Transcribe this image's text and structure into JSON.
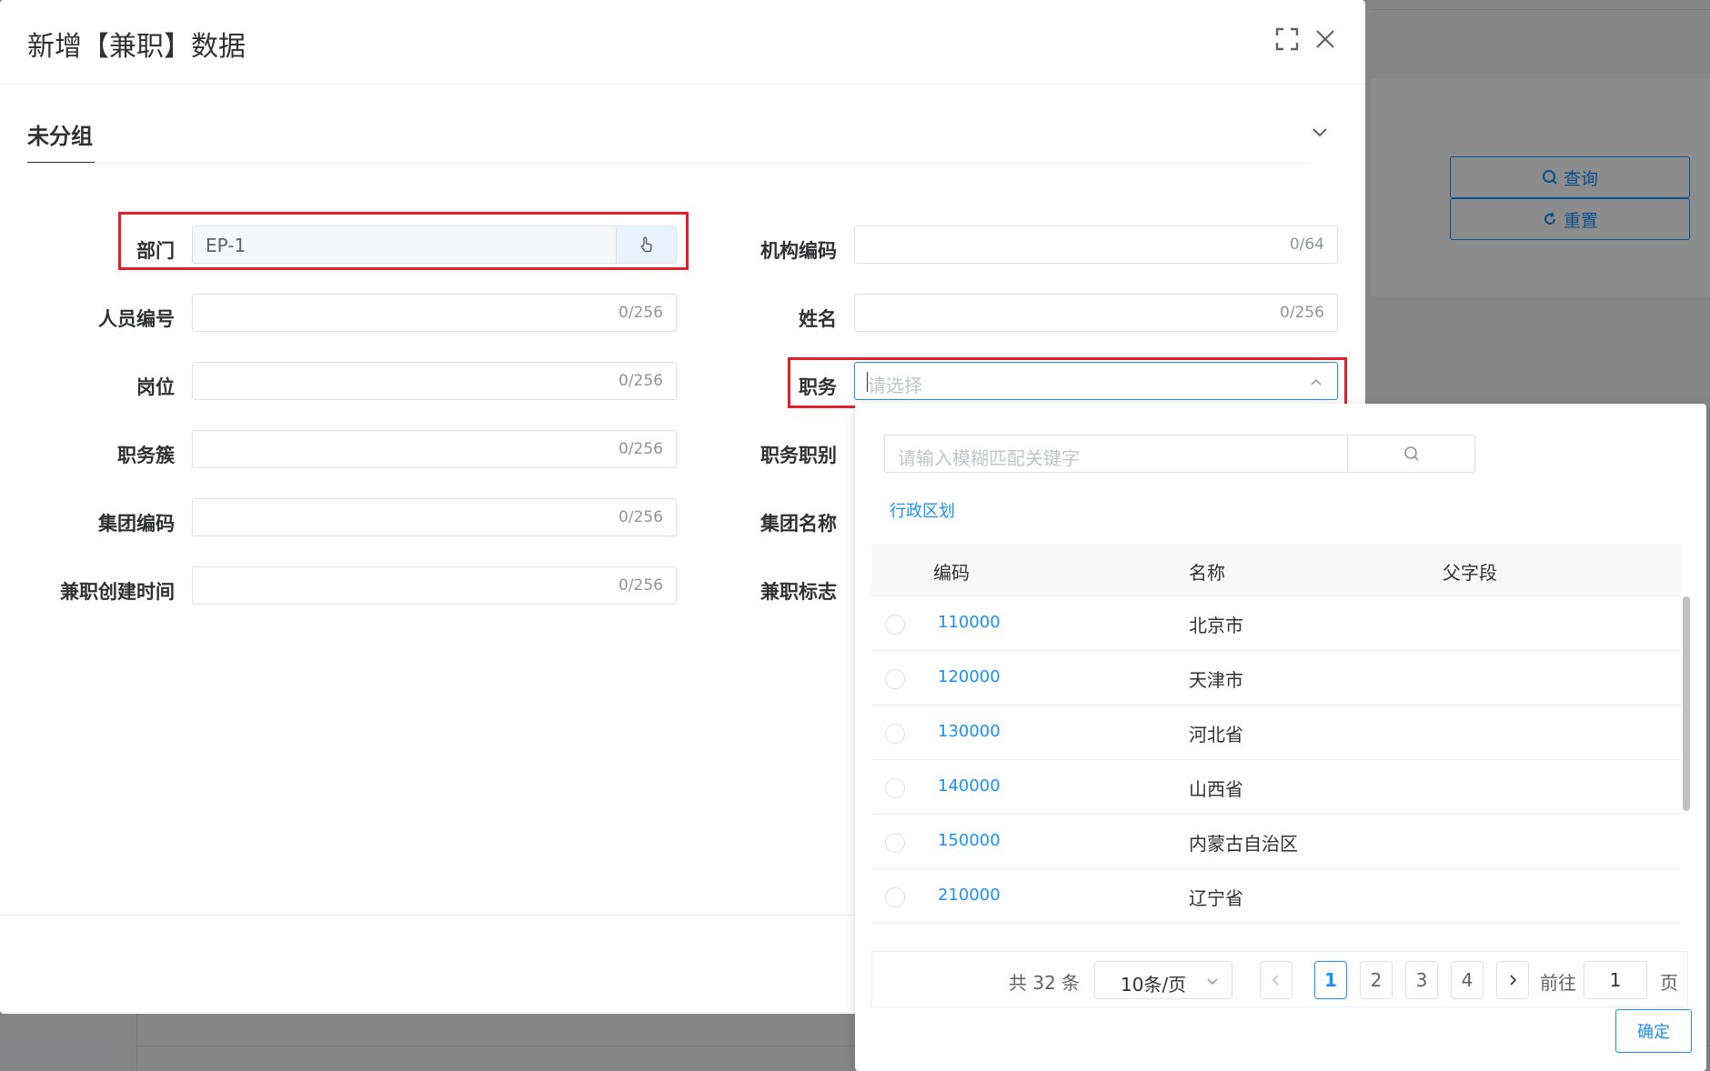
{
  "dialog": {
    "title": "新增【兼职】数据",
    "group_title": "未分组"
  },
  "background": {
    "query_label": "查询",
    "reset_label": "重置"
  },
  "form": {
    "department": {
      "label": "部门",
      "value": "EP-1"
    },
    "org_code": {
      "label": "机构编码",
      "counter": "0/64"
    },
    "person_no": {
      "label": "人员编号",
      "counter": "0/256"
    },
    "name": {
      "label": "姓名",
      "counter": "0/256"
    },
    "post": {
      "label": "岗位",
      "counter": "0/256"
    },
    "duty": {
      "label": "职务",
      "placeholder": "请选择"
    },
    "duty_cluster": {
      "label": "职务簇",
      "counter": "0/256"
    },
    "duty_level": {
      "label": "职务职别"
    },
    "group_code": {
      "label": "集团编码",
      "counter": "0/256"
    },
    "group_name": {
      "label": "集团名称"
    },
    "created_time": {
      "label": "兼职创建时间",
      "counter": "0/256"
    },
    "flag": {
      "label": "兼职标志"
    }
  },
  "dropdown": {
    "search_placeholder": "请输入模糊匹配关键字",
    "tab": "行政区划",
    "columns": [
      "编码",
      "名称",
      "父字段"
    ],
    "rows": [
      {
        "code": "110000",
        "name": "北京市"
      },
      {
        "code": "120000",
        "name": "天津市"
      },
      {
        "code": "130000",
        "name": "河北省"
      },
      {
        "code": "140000",
        "name": "山西省"
      },
      {
        "code": "150000",
        "name": "内蒙古自治区"
      },
      {
        "code": "210000",
        "name": "辽宁省"
      }
    ],
    "pagination": {
      "total": "共 32 条",
      "page_size": "10条/页",
      "pages": [
        "1",
        "2",
        "3",
        "4"
      ],
      "current": "1",
      "goto_label": "前往",
      "goto_value": "1",
      "goto_unit": "页"
    },
    "confirm_label": "确定"
  },
  "colors": {
    "primary": "#1890ff",
    "highlight": "#e5202a"
  }
}
